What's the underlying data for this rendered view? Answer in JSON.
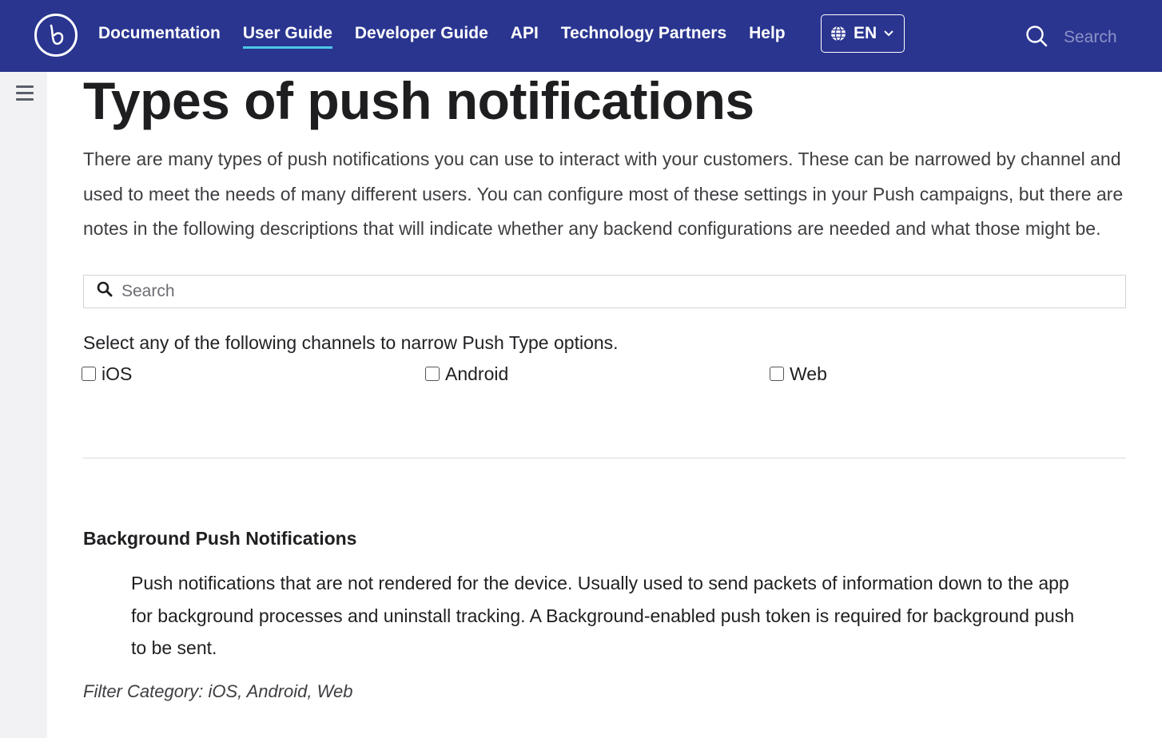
{
  "header": {
    "nav": [
      {
        "label": "Documentation",
        "active": false
      },
      {
        "label": "User Guide",
        "active": true
      },
      {
        "label": "Developer Guide",
        "active": false
      },
      {
        "label": "API",
        "active": false
      },
      {
        "label": "Technology Partners",
        "active": false
      },
      {
        "label": "Help",
        "active": false
      }
    ],
    "language": "EN",
    "search_placeholder": "Search"
  },
  "page": {
    "title": "Types of push notifications",
    "intro": "There are many types of push notifications you can use to interact with your customers. These can be narrowed by channel and used to meet the needs of many different users. You can configure most of these settings in your Push campaigns, but there are notes in the following descriptions that will indicate whether any backend configurations are needed and what those might be.",
    "filter_search_placeholder": "Search",
    "channels_prompt": "Select any of the following channels to narrow Push Type options.",
    "channels": [
      {
        "label": "iOS",
        "checked": false
      },
      {
        "label": "Android",
        "checked": false
      },
      {
        "label": "Web",
        "checked": false
      }
    ],
    "push_types": [
      {
        "title": "Background Push Notifications",
        "description": "Push notifications that are not rendered for the device. Usually used to send packets of information down to the app for background processes and uninstall tracking. A Background-enabled push token is required for background push to be sent.",
        "filter_category": "Filter Category: iOS, Android, Web"
      }
    ]
  },
  "colors": {
    "header_bg": "#2a3590",
    "active_underline": "#4dc8e6",
    "sidebar_bg": "#f2f2f4"
  },
  "icons": [
    "braze-logo-icon",
    "globe-icon",
    "chevron-down-icon",
    "search-icon",
    "hamburger-menu-icon"
  ]
}
